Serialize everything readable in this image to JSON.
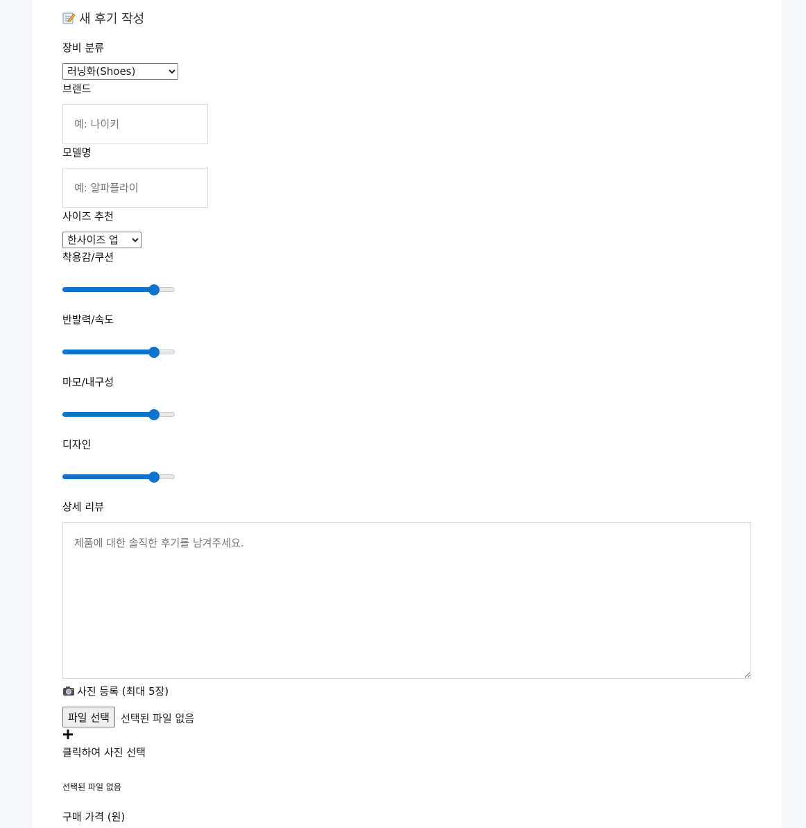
{
  "form": {
    "title": "새 후기 작성",
    "title_icon": "memo-icon",
    "category": {
      "label": "장비 분류",
      "selected": "러닝화(Shoes)"
    },
    "brand": {
      "label": "브랜드",
      "placeholder": "예: 나이키"
    },
    "model": {
      "label": "모델명",
      "placeholder": "예: 알파플라이"
    },
    "size": {
      "label": "사이즈 추천",
      "selected": "한사이즈 업"
    },
    "ratings": [
      {
        "label": "착용감/쿠션",
        "value": 0.85
      },
      {
        "label": "반발력/속도",
        "value": 0.85
      },
      {
        "label": "마모/내구성",
        "value": 0.85
      },
      {
        "label": "디자인",
        "value": 0.85
      }
    ],
    "review": {
      "label": "상세 리뷰",
      "placeholder": "제품에 대한 솔직한 후기를 남겨주세요."
    },
    "photos": {
      "label": "사진 등록 (최대 5장)",
      "icon": "camera-icon",
      "file_button": "파일 선택",
      "file_status": "선택된 파일 없음",
      "add_icon": "plus-icon",
      "add_label": "클릭하여 사진 선택",
      "selected_status": "선택된 파일 없음"
    },
    "price": {
      "label": "구매 가격 (원)"
    }
  },
  "colors": {
    "accent": "#0b74d1",
    "background": "#f7f8fa",
    "card": "#ffffff"
  }
}
